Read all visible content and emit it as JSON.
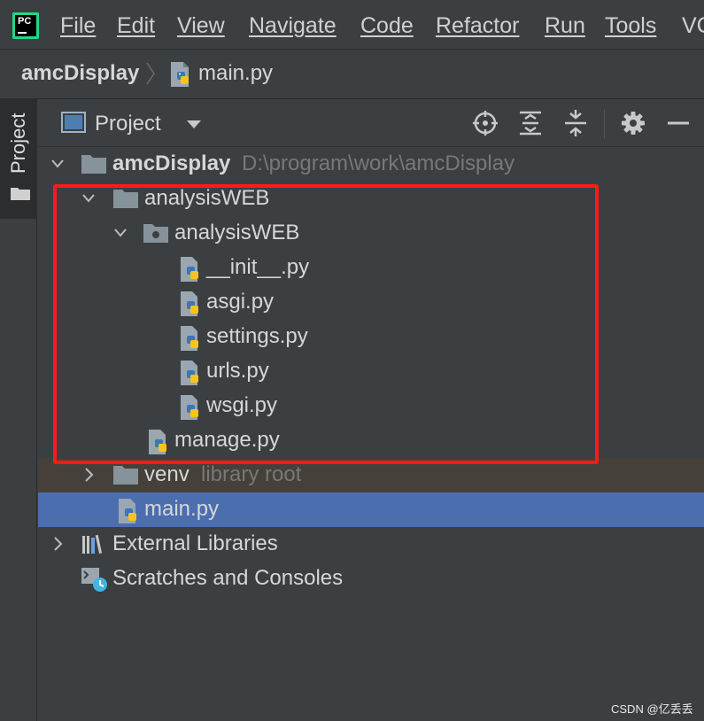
{
  "menubar": {
    "logo_text": "PC",
    "items": [
      {
        "label": "File"
      },
      {
        "label": "Edit"
      },
      {
        "label": "View"
      },
      {
        "label": "Navigate"
      },
      {
        "label": "Code"
      },
      {
        "label": "Refactor"
      },
      {
        "label": "Run"
      },
      {
        "label": "Tools"
      },
      {
        "label": "VC"
      }
    ]
  },
  "breadcrumb": {
    "project": "amcDisplay",
    "file": "main.py"
  },
  "left_stripe": {
    "tab_label": "Project"
  },
  "panel": {
    "title": "Project",
    "toolbar_icons": [
      "locate-icon",
      "expand-all-icon",
      "collapse-all-icon",
      "gear-icon",
      "minimize-icon"
    ]
  },
  "tree": {
    "root": {
      "label": "amcDisplay",
      "path": "D:\\program\\work\\amcDisplay"
    },
    "rows": [
      {
        "label": "analysisWEB"
      },
      {
        "label": "analysisWEB"
      },
      {
        "label": "__init__.py"
      },
      {
        "label": "asgi.py"
      },
      {
        "label": "settings.py"
      },
      {
        "label": "urls.py"
      },
      {
        "label": "wsgi.py"
      },
      {
        "label": "manage.py"
      },
      {
        "label": "venv",
        "hint": "library root"
      },
      {
        "label": "main.py"
      },
      {
        "label": "External Libraries"
      },
      {
        "label": "Scratches and Consoles"
      }
    ]
  },
  "watermark": "CSDN @亿丢丢",
  "colors": {
    "background": "#3c3f41",
    "selection": "#4b6eaf",
    "highlight_box": "#ff1a1a",
    "library_row": "#45413a"
  }
}
